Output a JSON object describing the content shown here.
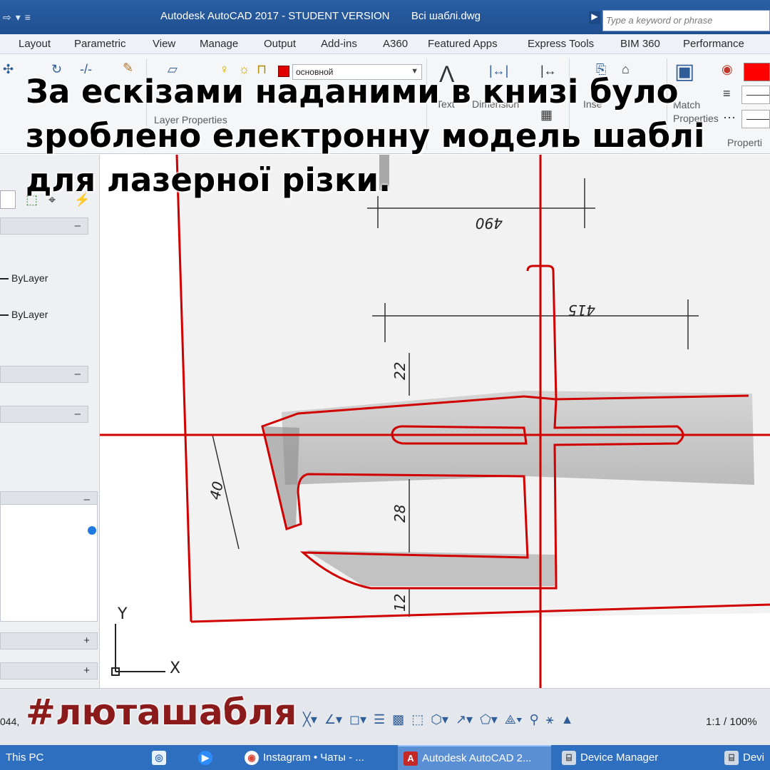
{
  "window": {
    "title": "Autodesk AutoCAD 2017 - STUDENT VERSION",
    "filename": "Всі шаблі.dwg",
    "search_placeholder": "Type a keyword or phrase"
  },
  "ribbon": {
    "tabs": [
      "Layout",
      "Parametric",
      "View",
      "Manage",
      "Output",
      "Add-ins",
      "A360",
      "Featured Apps",
      "Express Tools",
      "BIM 360",
      "Performance"
    ],
    "layer_name": "основной",
    "labels": {
      "layer_properties": "Layer Properties",
      "text": "Text",
      "dimension": "Dimension",
      "insert": "Inse",
      "match_properties": "Match Properties",
      "properties_panel": "Properti"
    }
  },
  "palette": {
    "bylayer_1": "ByLayer",
    "bylayer_2": "ByLayer"
  },
  "drawing": {
    "dims": [
      "490",
      "415",
      "22",
      "28",
      "40",
      "12"
    ],
    "ucs_x": "X",
    "ucs_y": "Y"
  },
  "caption": {
    "line1": "За ескізами наданими в книзі було",
    "line2": "зроблено електронну модель шаблі",
    "line3": "для лазерної різки."
  },
  "hashtag": "#люташабля",
  "statusbar": {
    "coord": "044,",
    "scale": "1:1 / 100%"
  },
  "taskbar": {
    "items": [
      "This PC",
      "Instagram • Чаты - ...",
      "Autodesk AutoCAD 2...",
      "Device Manager",
      "Devi"
    ]
  },
  "colors": {
    "outline_red": "#d10000",
    "title_blue": "#2a5fa5",
    "hashtag": "#8b1a1a"
  }
}
